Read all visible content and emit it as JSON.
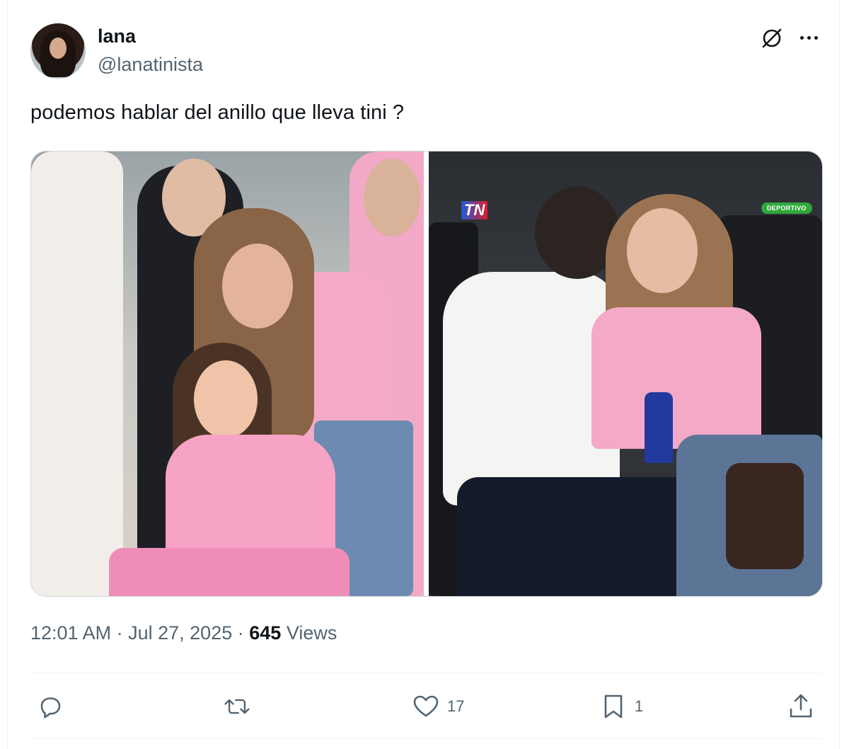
{
  "author": {
    "display_name": "lana",
    "handle": "@lanatinista",
    "avatar_icon": "profile-photo"
  },
  "header_icons": {
    "grok": "grok-icon",
    "more": "more-icon"
  },
  "tweet": {
    "text": "podemos hablar del anillo que lleva tini ?"
  },
  "media": {
    "count": 2,
    "right_photo_logo": "TN",
    "right_photo_badge": "DEPORTIVO"
  },
  "meta": {
    "time": "12:01 AM",
    "separator": "·",
    "date": "Jul 27, 2025",
    "views_count": "645",
    "views_label": "Views"
  },
  "actions": {
    "reply": {
      "icon": "reply-icon",
      "count": ""
    },
    "retweet": {
      "icon": "retweet-icon",
      "count": ""
    },
    "like": {
      "icon": "heart-icon",
      "count": "17"
    },
    "bookmark": {
      "icon": "bookmark-icon",
      "count": "1"
    },
    "share": {
      "icon": "share-icon",
      "count": ""
    }
  },
  "colors": {
    "text_primary": "#0f1419",
    "text_secondary": "#536471",
    "border": "#cfd9de",
    "divider": "#eff3f4"
  }
}
